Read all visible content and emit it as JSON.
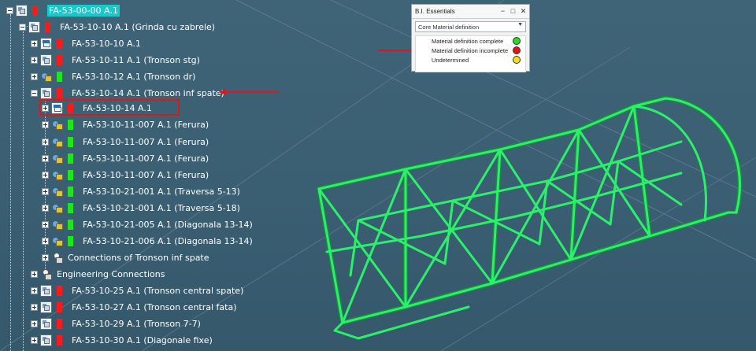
{
  "tree": {
    "root": {
      "label": "FA-53-00-00 A.1"
    },
    "grinda": {
      "label": "FA-53-10-10 A.1 (Grinda cu zabrele)"
    },
    "children": [
      {
        "label": "FA-53-10-10 A.1",
        "icon": "part-icon",
        "status": "red"
      },
      {
        "label": "FA-53-10-11 A.1 (Tronson stg)",
        "icon": "product-icon",
        "status": "red"
      },
      {
        "label": "FA-53-10-12 A.1 (Tronson dr)",
        "icon": "link-icon",
        "status": "green"
      },
      {
        "label": "FA-53-10-14 A.1 (Tronson inf spate)",
        "icon": "product-icon",
        "status": "red"
      }
    ],
    "tronson_children": [
      {
        "label": "FA-53-10-14 A.1",
        "icon": "part-icon",
        "status": "red"
      },
      {
        "label": "FA-53-10-11-007 A.1 (Ferura)",
        "icon": "link-icon",
        "status": "green"
      },
      {
        "label": "FA-53-10-11-007 A.1 (Ferura)",
        "icon": "link-icon",
        "status": "green"
      },
      {
        "label": "FA-53-10-11-007 A.1 (Ferura)",
        "icon": "link-icon",
        "status": "green"
      },
      {
        "label": "FA-53-10-11-007 A.1 (Ferura)",
        "icon": "link-icon",
        "status": "green"
      },
      {
        "label": "FA-53-10-21-001 A.1 (Traversa 5-13)",
        "icon": "link-icon",
        "status": "green"
      },
      {
        "label": "FA-53-10-21-001 A.1 (Traversa 5-18)",
        "icon": "link-icon",
        "status": "green"
      },
      {
        "label": "FA-53-10-21-005 A.1 (Diagonala 13-14)",
        "icon": "link-icon",
        "status": "green"
      },
      {
        "label": "FA-53-10-21-006 A.1 (Diagonala 13-14)",
        "icon": "link-icon",
        "status": "green"
      }
    ],
    "connections": [
      {
        "label": "Connections of Tronson inf spate",
        "icon": "connections-icon"
      },
      {
        "label": "Engineering Connections",
        "icon": "connections-icon"
      }
    ],
    "more_children": [
      {
        "label": "FA-53-10-25 A.1 (Tronson central spate)",
        "icon": "product-icon",
        "status": "red"
      },
      {
        "label": "FA-53-10-27 A.1 (Tronson central fata)",
        "icon": "product-icon",
        "status": "red"
      },
      {
        "label": "FA-53-10-29 A.1 (Tronson 7-7)",
        "icon": "product-icon",
        "status": "red"
      },
      {
        "label": "FA-53-10-30 A.1 (Diagonale fixe)",
        "icon": "product-icon",
        "status": "red"
      }
    ]
  },
  "panel": {
    "title": "B.I. Essentials",
    "dropdown_value": "Core Material definition",
    "legend": [
      {
        "label": "Material definition complete",
        "color": "#22dd22"
      },
      {
        "label": "Material definition incomplete",
        "color": "#ee1111"
      },
      {
        "label": "Undetermined",
        "color": "#f3e01a"
      }
    ]
  },
  "colors": {
    "status_red": "#ff1a1a",
    "status_green": "#1ee61e",
    "root_highlight": "#18c8cf",
    "annotation_red": "#e0161c",
    "model_green": "#22e05a"
  }
}
